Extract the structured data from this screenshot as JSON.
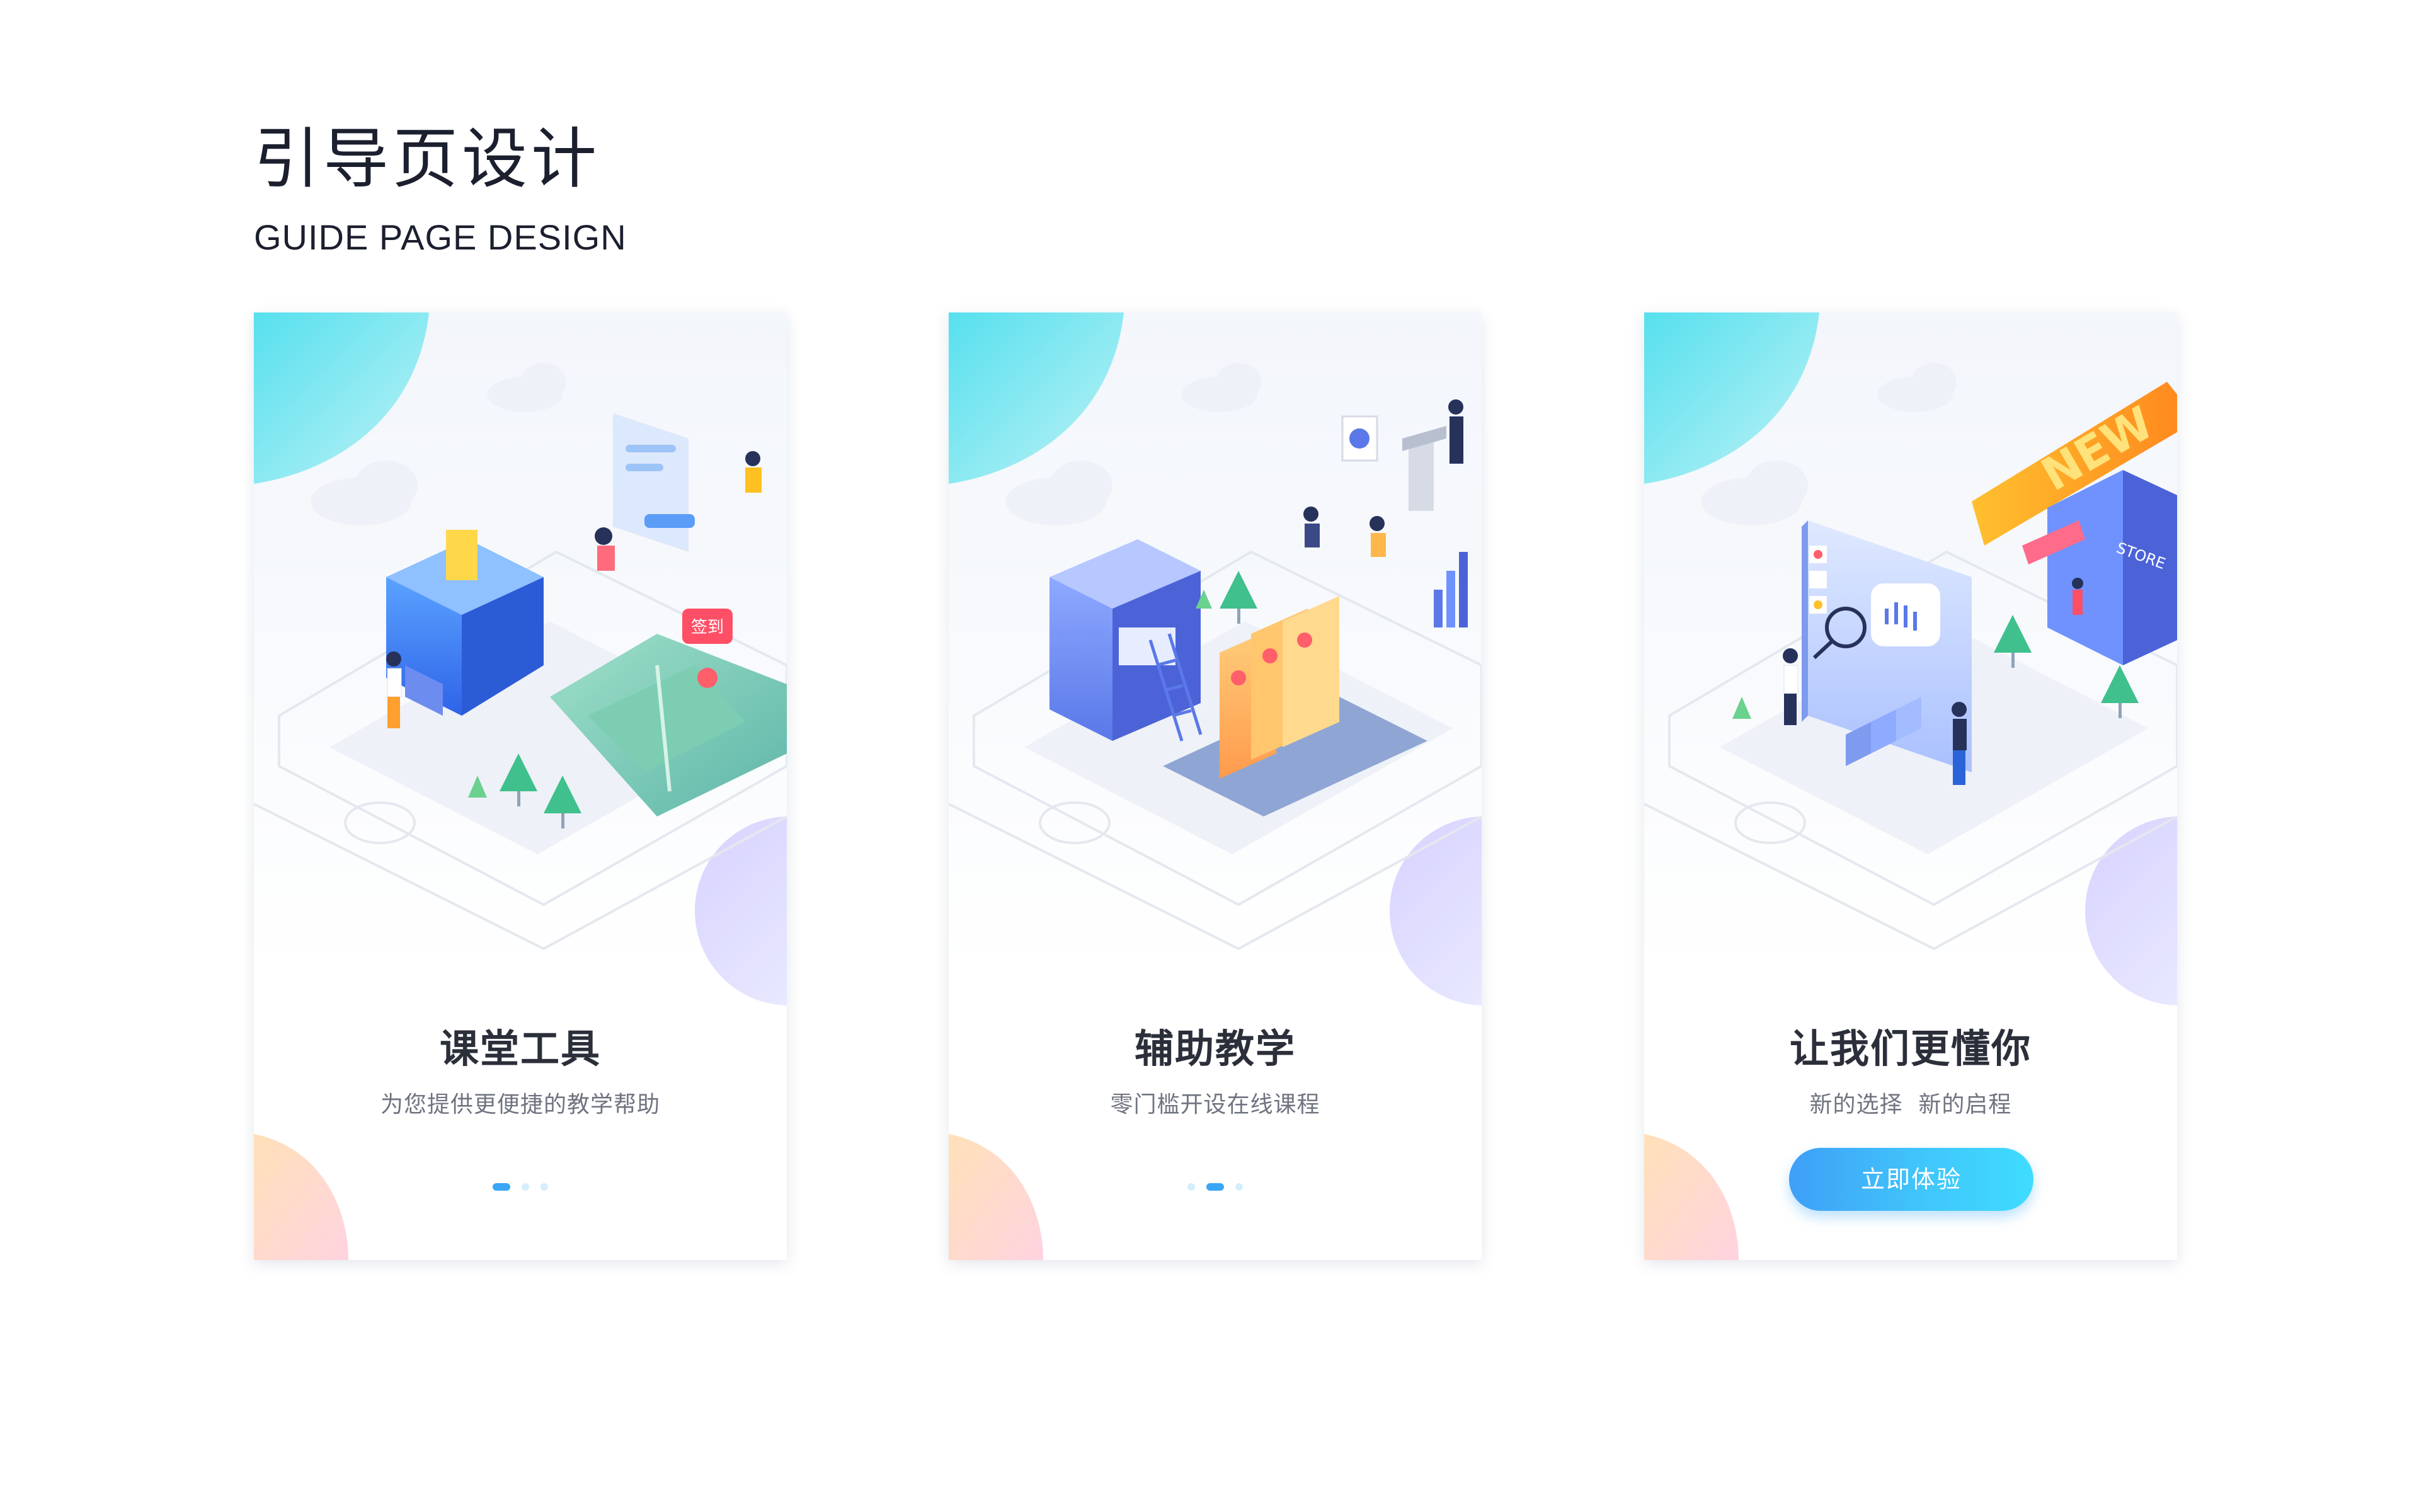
{
  "header": {
    "title_cn": "引导页设计",
    "title_en": "GUIDE PAGE DESIGN"
  },
  "colors": {
    "accent": "#3aa6f5",
    "dot_inactive": "#d6eefc",
    "button_start": "#3f9ff7",
    "button_end": "#3fdcff",
    "heading": "#2b2f3a",
    "subtext": "#6f7480"
  },
  "cards": [
    {
      "heading": "课堂工具",
      "subtitle": "为您提供更便捷的教学帮助",
      "illustration": "classroom-tools-illustration",
      "sign_label": "签到",
      "active_page": 1,
      "page_count": 3
    },
    {
      "heading": "辅助教学",
      "subtitle": "零门槛开设在线课程",
      "illustration": "teaching-assist-illustration",
      "active_page": 2,
      "page_count": 3
    },
    {
      "heading": "让我们更懂你",
      "subtitle": "新的选择  新的启程",
      "illustration": "understand-you-illustration",
      "new_label": "NEW",
      "store_label": "STORE",
      "button_label": "立即体验"
    }
  ]
}
